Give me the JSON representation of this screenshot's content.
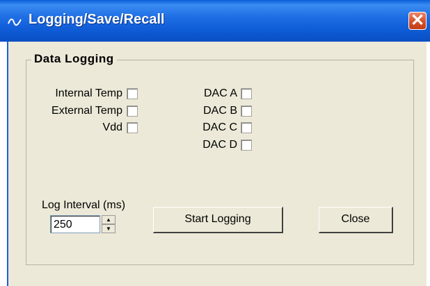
{
  "window": {
    "title": "Logging/Save/Recall",
    "close_glyph": "✕"
  },
  "group": {
    "title": "Data  Logging"
  },
  "temps": [
    {
      "label": "Internal Temp",
      "checked": false
    },
    {
      "label": "External Temp",
      "checked": false
    },
    {
      "label": "Vdd",
      "checked": false
    }
  ],
  "dacs": [
    {
      "label": "DAC A",
      "checked": false
    },
    {
      "label": "DAC B",
      "checked": false
    },
    {
      "label": "DAC C",
      "checked": false
    },
    {
      "label": "DAC D",
      "checked": false
    }
  ],
  "log_interval": {
    "label": "Log Interval (ms)",
    "value": "250"
  },
  "buttons": {
    "start": "Start Logging",
    "close": "Close"
  },
  "colors": {
    "titlebar": "#0d5ad4",
    "client_bg": "#ece9d8",
    "close_button": "#d9532c"
  }
}
